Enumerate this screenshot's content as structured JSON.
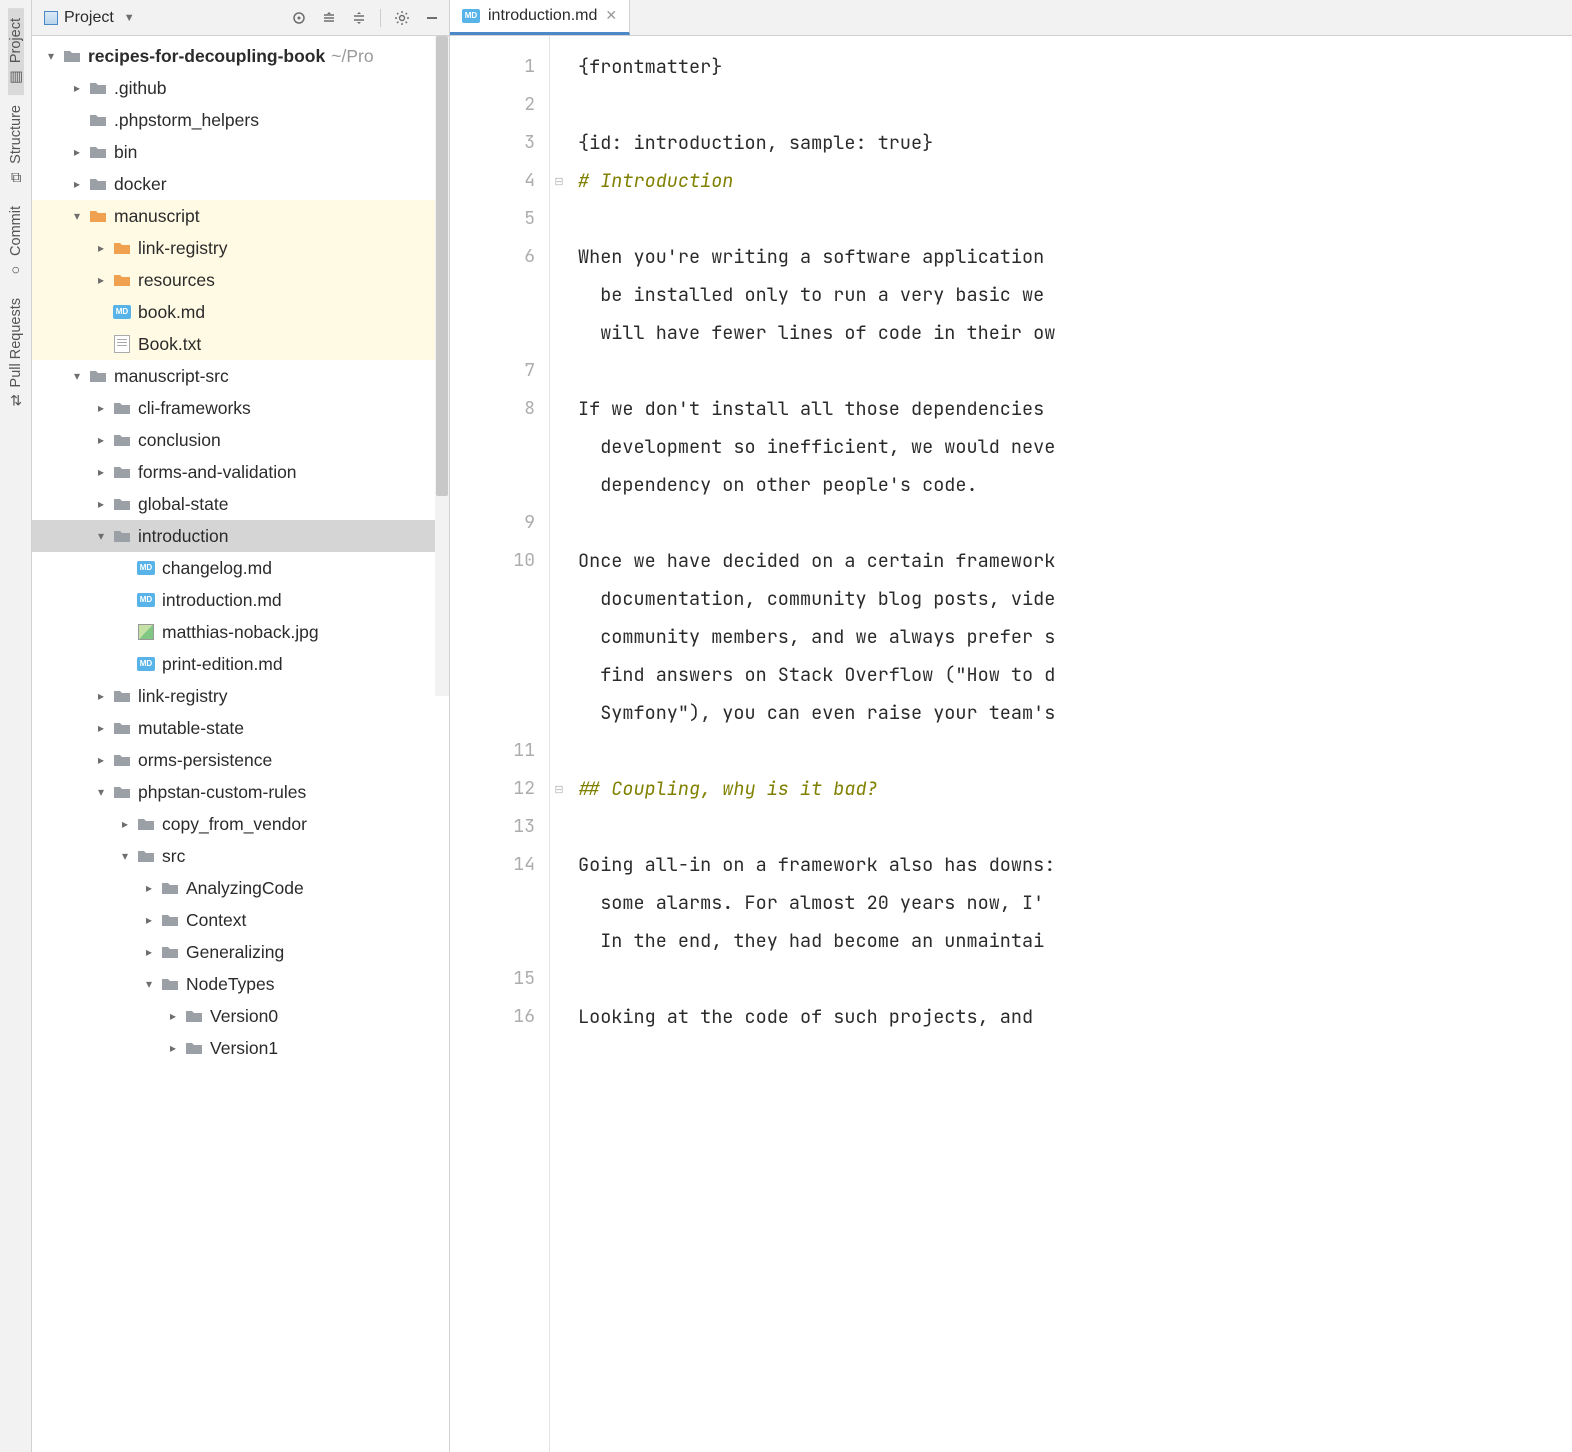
{
  "toolstrip": {
    "project": "Project",
    "structure": "Structure",
    "commit": "Commit",
    "pull_requests": "Pull Requests"
  },
  "project_header": {
    "title": "Project"
  },
  "tree": {
    "root": {
      "label": "recipes-for-decoupling-book",
      "suffix": "~/Pro"
    },
    "github": ".github",
    "phpstorm_helpers": ".phpstorm_helpers",
    "bin": "bin",
    "docker": "docker",
    "manuscript": "manuscript",
    "link_registry": "link-registry",
    "resources": "resources",
    "book_md": "book.md",
    "book_txt": "Book.txt",
    "manuscript_src": "manuscript-src",
    "cli_frameworks": "cli-frameworks",
    "conclusion": "conclusion",
    "forms_validation": "forms-and-validation",
    "global_state": "global-state",
    "introduction": "introduction",
    "changelog_md": "changelog.md",
    "introduction_md": "introduction.md",
    "matthias_jpg": "matthias-noback.jpg",
    "print_edition_md": "print-edition.md",
    "link_registry2": "link-registry",
    "mutable_state": "mutable-state",
    "orms_persistence": "orms-persistence",
    "phpstan_rules": "phpstan-custom-rules",
    "copy_from_vendor": "copy_from_vendor",
    "src": "src",
    "analyzing_code": "AnalyzingCode",
    "context": "Context",
    "generalizing": "Generalizing",
    "node_types": "NodeTypes",
    "version0": "Version0",
    "version1": "Version1"
  },
  "tab": {
    "label": "introduction.md"
  },
  "gutter_lines": [
    "1",
    "2",
    "3",
    "4",
    "5",
    "6",
    "7",
    "8",
    "9",
    "10",
    "11",
    "12",
    "13",
    "14",
    "15",
    "16"
  ],
  "code": {
    "l1": "{frontmatter}",
    "l2": "",
    "l3": "{id: introduction, sample: true}",
    "l4a": "#",
    "l4b": " Introduction",
    "l5": "",
    "l6": "When you're writing a software application \n  be installed only to run a very basic we\n  will have fewer lines of code in their ow",
    "l7": "",
    "l8": "If we don't install all those dependencies \n  development so inefficient, we would neve\n  dependency on other people's code.",
    "l9": "",
    "l10": "Once we have decided on a certain framework\n  documentation, community blog posts, vide\n  community members, and we always prefer s\n  find answers on Stack Overflow (\"How to d\n  Symfony\"), you can even raise your team's",
    "l11": "",
    "l12a": "##",
    "l12b": " Coupling, why is it bad?",
    "l13": "",
    "l14": "Going all-in on a framework also has downs:\n  some alarms. For almost 20 years now, I'\n  In the end, they had become an unmaintai",
    "l15": "",
    "l16": "Looking at the code of such projects, and "
  }
}
